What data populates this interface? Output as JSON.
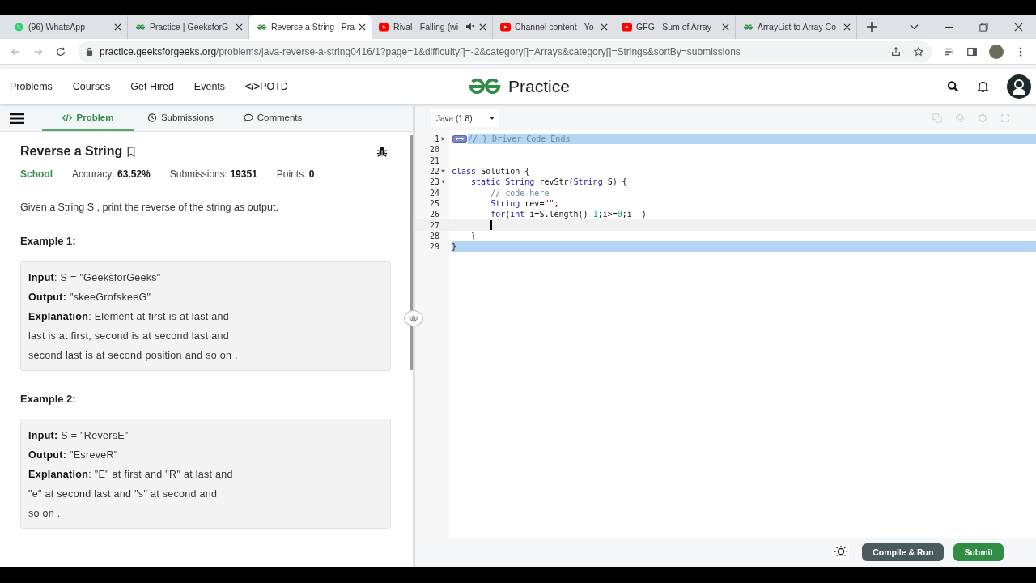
{
  "browser": {
    "tabs": [
      {
        "title": "(96) WhatsApp",
        "kind": "chat",
        "selected": false,
        "muted": false
      },
      {
        "title": "Practice | GeeksforG",
        "kind": "gfg",
        "selected": false,
        "muted": false
      },
      {
        "title": "Reverse a String | Pra",
        "kind": "gfg",
        "selected": true,
        "muted": false
      },
      {
        "title": "Rival - Falling (wi",
        "kind": "video",
        "selected": false,
        "muted": true
      },
      {
        "title": "Channel content - Yo",
        "kind": "video",
        "selected": false,
        "muted": false
      },
      {
        "title": "GFG - Sum of Array",
        "kind": "video",
        "selected": false,
        "muted": false
      },
      {
        "title": "ArrayList to Array Co",
        "kind": "gfg",
        "selected": false,
        "muted": false
      }
    ],
    "url_host": "practice.geeksforgeeks.org",
    "url_path": "/problems/java-reverse-a-string0416/1?page=1&difficulty[]=-2&category[]=Arrays&category[]=Strings&sortBy=submissions"
  },
  "site": {
    "nav": [
      "Problems",
      "Courses",
      "Get Hired",
      "Events"
    ],
    "potd_mark": "</>",
    "potd": "POTD",
    "logo_text": "Practice"
  },
  "problem_tabs": [
    {
      "label": "Problem",
      "selected": true
    },
    {
      "label": "Submissions",
      "selected": false
    },
    {
      "label": "Comments",
      "selected": false
    }
  ],
  "problem": {
    "title": "Reverse a String",
    "difficulty": "School",
    "accuracy_label": "Accuracy:",
    "accuracy": "63.52%",
    "submissions_label": "Submissions:",
    "submissions": "19351",
    "points_label": "Points:",
    "points": "0",
    "statement": "Given a String S , print the reverse of the string as output.",
    "examples": [
      {
        "heading": "Example 1:",
        "lines": [
          "**Input**: S = \"GeeksforGeeks\"",
          "**Output:** \"skeeGrofskeeG\"",
          "**Explanation**: Element at first is at last and",
          "last is at first, second is at second last and",
          "second last is at second position and so on ."
        ]
      },
      {
        "heading": "Example 2:",
        "lines": [
          "**Input:** S = \"ReversE\"",
          "**Output:** \"EsreveR\"",
          "**Explanation**: \"E\" at first and \"R\" at last and",
          "\"e\" at second last and \"s\" at second and",
          "so on ."
        ]
      }
    ]
  },
  "editor": {
    "language": "Java (1.8)",
    "lines": [
      {
        "number": "1",
        "kind": "folded",
        "selected": true,
        "active": false,
        "tokens": [
          {
            "kind": "comment",
            "text": "// } Driver Code Ends"
          }
        ]
      },
      {
        "number": "20",
        "kind": "plain",
        "selected": false,
        "active": false
      },
      {
        "number": "21",
        "kind": "plain",
        "selected": false,
        "active": false
      },
      {
        "number": "22",
        "kind": "foldable",
        "selected": false,
        "active": false,
        "tokens": [
          {
            "kind": "keyword",
            "text": "class"
          },
          {
            "kind": "plain",
            "text": " Solution {"
          }
        ]
      },
      {
        "number": "23",
        "kind": "foldable",
        "selected": false,
        "active": false,
        "tokens": [
          {
            "kind": "keyword",
            "text": "    static"
          },
          {
            "kind": "type",
            "text": " String"
          },
          {
            "kind": "plain",
            "text": " revStr("
          },
          {
            "kind": "type",
            "text": "String"
          },
          {
            "kind": "plain",
            "text": " S) {"
          }
        ]
      },
      {
        "number": "24",
        "kind": "plain",
        "selected": false,
        "active": false,
        "tokens": [
          {
            "kind": "comment",
            "text": "        // code here"
          }
        ]
      },
      {
        "number": "25",
        "kind": "plain",
        "selected": false,
        "active": false,
        "tokens": [
          {
            "kind": "type",
            "text": "        String"
          },
          {
            "kind": "plain",
            "text": " rev="
          },
          {
            "kind": "string",
            "text": "\"\""
          },
          {
            "kind": "plain",
            "text": ";"
          }
        ]
      },
      {
        "number": "26",
        "kind": "plain",
        "selected": false,
        "active": false,
        "tokens": [
          {
            "kind": "keyword",
            "text": "        for"
          },
          {
            "kind": "plain",
            "text": "("
          },
          {
            "kind": "keyword",
            "text": "int"
          },
          {
            "kind": "plain",
            "text": " i=S.length()-"
          },
          {
            "kind": "number",
            "text": "1"
          },
          {
            "kind": "plain",
            "text": ";i>="
          },
          {
            "kind": "number",
            "text": "0"
          },
          {
            "kind": "plain",
            "text": ";i--)"
          }
        ]
      },
      {
        "number": "27",
        "kind": "plain",
        "selected": false,
        "active": true
      },
      {
        "number": "28",
        "kind": "plain",
        "selected": false,
        "active": false,
        "tokens": [
          {
            "kind": "plain",
            "text": "    }"
          }
        ]
      },
      {
        "number": "29",
        "kind": "plain",
        "selected": true,
        "active": false,
        "tokens": [
          {
            "kind": "plain",
            "text": "}"
          }
        ]
      }
    ]
  },
  "actions": [
    {
      "label": "Compile & Run",
      "kind": "secondary"
    },
    {
      "label": "Submit",
      "kind": "primary"
    }
  ]
}
